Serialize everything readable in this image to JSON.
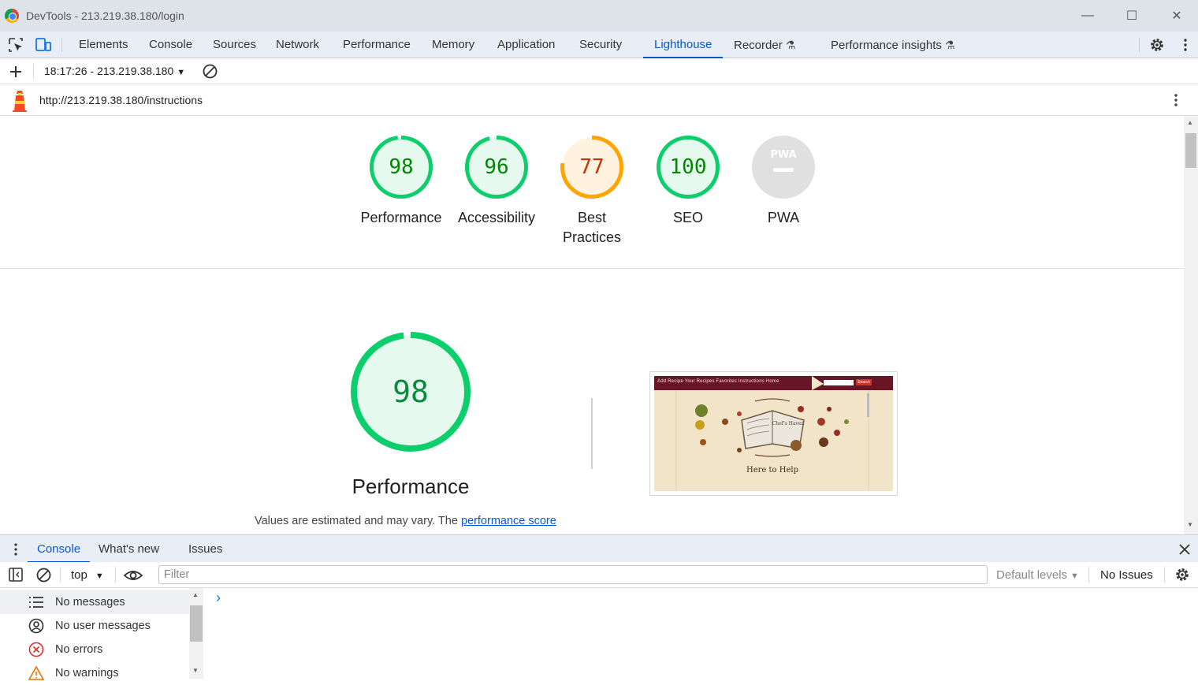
{
  "window": {
    "title": "DevTools - 213.219.38.180/login",
    "minimize_glyph": "—",
    "maximize_glyph": "☐",
    "close_glyph": "✕"
  },
  "tabs": [
    {
      "label": "Elements"
    },
    {
      "label": "Console"
    },
    {
      "label": "Sources"
    },
    {
      "label": "Network"
    },
    {
      "label": "Performance"
    },
    {
      "label": "Memory"
    },
    {
      "label": "Application"
    },
    {
      "label": "Security"
    },
    {
      "label": "Lighthouse",
      "active": true
    },
    {
      "label": "Recorder"
    },
    {
      "label": "Performance insights"
    }
  ],
  "lighthouse": {
    "report_selector": "18:17:26 - 213.219.38.180",
    "url": "http://213.219.38.180/instructions"
  },
  "scores": [
    {
      "label": "Performance",
      "value": "98",
      "fraction": 0.98,
      "status": "pass"
    },
    {
      "label": "Accessibility",
      "value": "96",
      "fraction": 0.96,
      "status": "pass"
    },
    {
      "label": "Best",
      "label2": "Practices",
      "value": "77",
      "fraction": 0.77,
      "status": "average"
    },
    {
      "label": "SEO",
      "value": "100",
      "fraction": 1.0,
      "status": "pass"
    },
    {
      "label": "PWA",
      "value": "",
      "fraction": 0,
      "status": "na",
      "badge": "PWA"
    }
  ],
  "performance_section": {
    "score": "98",
    "fraction": 0.98,
    "title": "Performance",
    "estimate_text": "Values are estimated and may vary. The ",
    "estimate_link": "performance score"
  },
  "screenshot": {
    "nav_text": "Add Recipe   Your Recipes   Favorites   Instructions   Home",
    "button": "Search",
    "tagline": "Here to Help",
    "book_text": "Chef's Haven"
  },
  "drawer": {
    "tabs": [
      {
        "label": "Console",
        "active": true
      },
      {
        "label": "What's new"
      },
      {
        "label": "Issues"
      }
    ],
    "context": "top",
    "filter_placeholder": "Filter",
    "levels": "Default levels",
    "issues": "No Issues",
    "prompt": "›",
    "sidebar": [
      {
        "label": "No messages",
        "icon": "list-icon"
      },
      {
        "label": "No user messages",
        "icon": "user-icon"
      },
      {
        "label": "No errors",
        "icon": "error-icon"
      },
      {
        "label": "No warnings",
        "icon": "warning-icon"
      }
    ]
  },
  "colors": {
    "pass": "#0cce6b",
    "pass_text": "#008800",
    "average": "#ffa400",
    "average_text": "#c33300",
    "na": "#e0e0e0",
    "accent": "#0b57d0"
  }
}
